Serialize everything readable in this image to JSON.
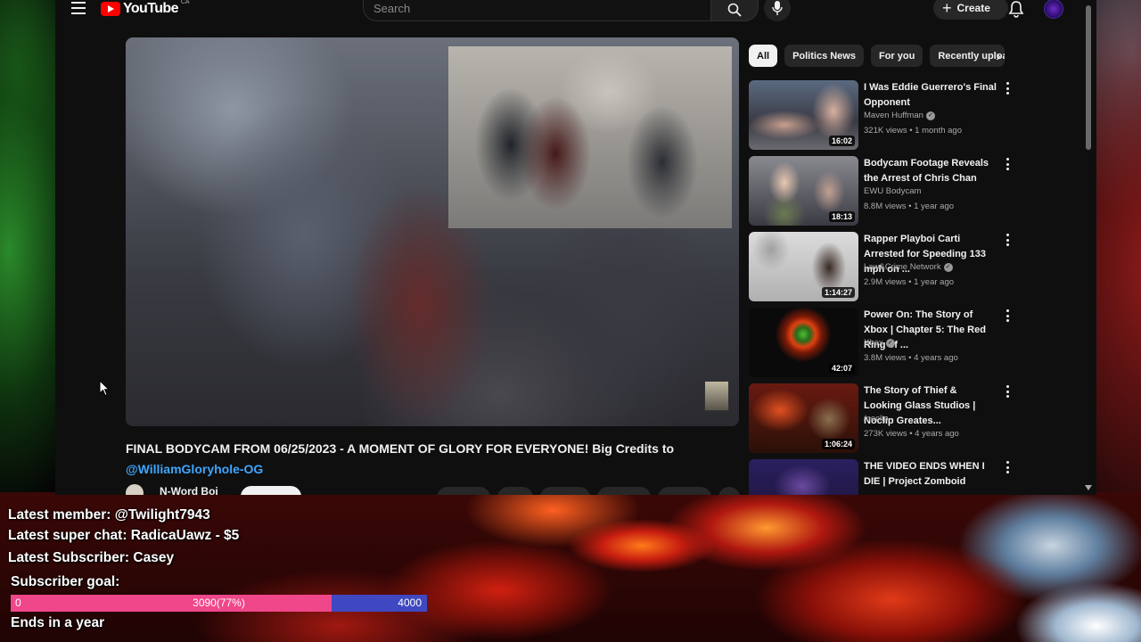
{
  "masthead": {
    "logo_text": "YouTube",
    "logo_country": "CA",
    "search_placeholder": "Search",
    "create_label": "Create"
  },
  "video": {
    "title": "FINAL BODYCAM FROM 06/25/2023 - A MOMENT OF GLORY FOR EVERYONE! Big Credits to",
    "title_mention": "@WilliamGloryhole-OG",
    "channel_name": "N-Word Boi"
  },
  "chips": [
    {
      "label": "All",
      "active": true
    },
    {
      "label": "Politics News",
      "active": false
    },
    {
      "label": "For you",
      "active": false
    },
    {
      "label": "Recently uploaded",
      "active": false
    }
  ],
  "recommendations": [
    {
      "title": "I Was Eddie Guerrero's Final Opponent",
      "channel": "Maven Huffman",
      "verified": true,
      "meta": "321K views • 1 month ago",
      "duration": "16:02"
    },
    {
      "title": "Bodycam Footage Reveals the Arrest of Chris Chan",
      "channel": "EWU Bodycam",
      "verified": false,
      "meta": "8.8M views • 1 year ago",
      "duration": "18:13"
    },
    {
      "title": "Rapper Playboi Carti Arrested for Speeding 133 mph on ...",
      "channel": "Law&Crime Network",
      "verified": true,
      "meta": "2.9M views • 1 year ago",
      "duration": "1:14:27"
    },
    {
      "title": "Power On: The Story of Xbox | Chapter 5: The Red Ring of ...",
      "channel": "Xbox",
      "verified": true,
      "meta": "3.8M views • 4 years ago",
      "duration": "42:07"
    },
    {
      "title": "The Story of Thief & Looking Glass Studios | Noclip Greates...",
      "channel": "/noclip",
      "verified": false,
      "meta": "273K views • 4 years ago",
      "duration": "1:06:24"
    },
    {
      "title": "THE VIDEO ENDS WHEN I DIE | Project Zomboid",
      "channel": "",
      "verified": false,
      "meta": "",
      "duration": ""
    }
  ],
  "overlay": {
    "latest_member": "Latest member: @Twilight7943",
    "latest_superchat": "Latest super chat: RadicaUawz  - $5",
    "latest_subscriber": "Latest Subscriber: Casey",
    "goal_label": "Subscriber goal:",
    "goal_start": "0",
    "goal_current": "3090(77%)",
    "goal_target": "4000",
    "goal_fraction": 0.77,
    "ends": "Ends in a year"
  },
  "colors": {
    "yt_bg": "#0f0f0f",
    "goal_fill": "#f0468a",
    "goal_remaining": "#3f48c0",
    "link": "#3ea6ff"
  }
}
